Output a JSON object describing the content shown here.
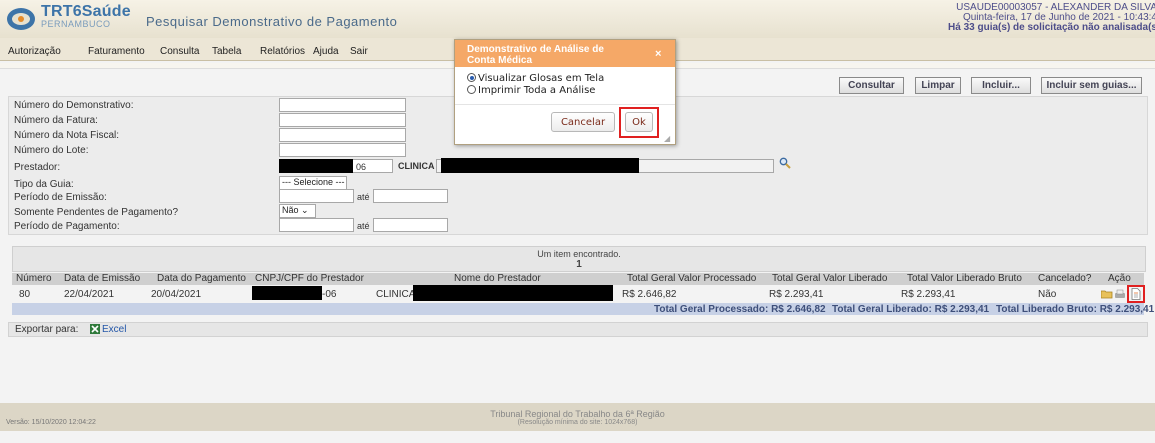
{
  "app": {
    "brand_name": "TRT6Saúde",
    "brand_sub": "PERNAMBUCO",
    "page_title": "Pesquisar Demonstrativo de Pagamento"
  },
  "user": {
    "line1": "USAUDE00003057 - ALEXANDER DA SILVA",
    "line2": "Quinta-feira, 17 de Junho de 2021 - 10:43:4",
    "line3": "Há 33 guia(s) de solicitação não analisada(s"
  },
  "menu": [
    "Autorização",
    "Faturamento",
    "Consulta",
    "Tabela",
    "Relatórios",
    "Ajuda",
    "Sair"
  ],
  "toolbar": {
    "consultar": "Consultar",
    "limpar": "Limpar",
    "incluir": "Incluir...",
    "incluir_sem_guias": "Incluir sem guias..."
  },
  "form": {
    "numero_demonstrativo": "Número do Demonstrativo:",
    "numero_fatura": "Número da Fatura:",
    "numero_nota_fiscal": "Número da Nota Fiscal:",
    "numero_lote": "Número do Lote:",
    "prestador": "Prestador:",
    "prestador_code_suffix": "06",
    "prestador_name_prefix": "CLINICA",
    "tipo_guia": "Tipo da Guia:",
    "tipo_guia_value": "--- Selecione ---",
    "periodo_emissao": "Período de Emissão:",
    "ate": "até",
    "somente_pendentes": "Somente Pendentes de Pagamento?",
    "somente_pendentes_value": "Não",
    "periodo_pagamento": "Período de Pagamento:"
  },
  "results": {
    "status": "Um item encontrado.",
    "page": "1",
    "headers": [
      "Número",
      "Data de Emissão",
      "Data do Pagamento",
      "CNPJ/CPF do Prestador",
      "Nome do Prestador",
      "Total Geral Valor Processado",
      "Total Geral Valor Liberado",
      "Total Valor Liberado Bruto",
      "Cancelado?",
      "Ação"
    ],
    "row": {
      "numero": "80",
      "data_emissao": "22/04/2021",
      "data_pagamento": "20/04/2021",
      "cnpj_suffix": "-06",
      "nome_prefix": "CLINICA",
      "valor_processado": "R$ 2.646,82",
      "valor_liberado": "R$ 2.293,41",
      "liberado_bruto": "R$ 2.293,41",
      "cancelado": "Não"
    },
    "totals": {
      "processado": "Total Geral Processado: R$ 2.646,82",
      "liberado": "Total Geral Liberado: R$ 2.293,41",
      "bruto": "Total Liberado Bruto: R$ 2.293,41"
    }
  },
  "export": {
    "label": "Exportar para:",
    "excel": "Excel"
  },
  "footer": {
    "version": "Versão: 15/10/2020 12:04:22",
    "org": "Tribunal Regional do Trabalho da 6ª Região",
    "resolution": "(Resolução mínima do site: 1024x768)"
  },
  "modal": {
    "title_line1": "Demonstrativo de Análise de",
    "title_line2": "Conta Médica",
    "close": "×",
    "option1": "Visualizar Glosas em Tela",
    "option2": "Imprimir Toda a Análise",
    "cancel": "Cancelar",
    "ok": "Ok"
  },
  "colors": {
    "modal_header": "#f5a867",
    "highlight": "#e02020",
    "totals_row": "#c7d1e6",
    "brand": "#3d74a8"
  }
}
